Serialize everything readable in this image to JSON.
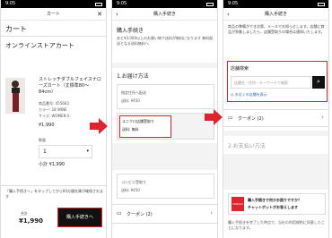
{
  "status_time": "9:05",
  "p1": {
    "header": "カート",
    "title": "カート",
    "subtitle": "オンラインストアカート",
    "product_name": "ストレッチダブルフェイスナローズカート（丈標準80〜84cm）",
    "product_no": "商品番号: 455663",
    "color": "カラー: 18 WINE",
    "size": "サイズ: WOMEN S",
    "price": "¥1,990",
    "qty_label": "数量",
    "qty_value": "1",
    "subtotal": "小計 ¥1,990",
    "note": "「購入手続きへ」をタップしてから60分間在庫が確保されます",
    "total_label": "合計",
    "total": "¥1,990",
    "checkout": "購入手続きへ"
  },
  "p2": {
    "header": "購入手続き",
    "title": "購入手続き",
    "note": "あと¥3,000以上のお買い物で送料が無料になります 無料配送となる送料無料へ",
    "section1": "1.お届け方法",
    "opt1_title": "指定住所へ配送",
    "opt1_fee": "送料: ¥450",
    "opt2_title": "ユニクロ店舗受取り",
    "opt2_fee": "送料: 無料",
    "opt3_title": "コンビニ受取り",
    "opt3_fee": "送料: ¥450",
    "coupon": "クーポン (2)"
  },
  "p3": {
    "header": "購入手続き",
    "intro": "商品の準備ができ次第、メールでお知らせします。店舗に商品が到着しましたら、店舗受取りの場合は通知いたします。",
    "store_search": "店舗検索",
    "search_placeholder": "店舗名・住所・キーワードで検索",
    "nearby": "お近くの店舗を表示",
    "coupon": "クーポン (2)",
    "section2": "2.お支払い方法",
    "banner_title": "購入手続きで何かお困りですか？",
    "banner_sub": "チャットボットがお答えします",
    "banner_icon_text": "UNIQLO",
    "footer": "購入手続きを完了した時点で、当社の利用規約に同意したことになります。"
  }
}
